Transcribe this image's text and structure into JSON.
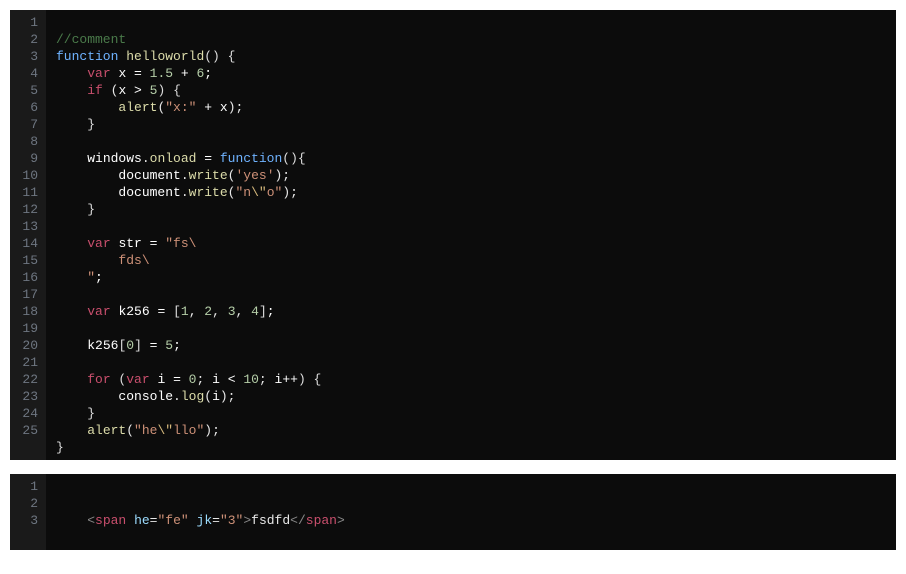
{
  "editors": [
    {
      "language": "javascript",
      "line_count": 25,
      "lines": {
        "l1": {
          "comment": "//comment"
        },
        "l2": {
          "kw": "function",
          "name": "helloworld",
          "p": "() {"
        },
        "l3": {
          "kw": "var",
          "id": "x",
          "eq": " = ",
          "n1": "1.5",
          "op": " + ",
          "n2": "6",
          "sc": ";"
        },
        "l4": {
          "kw": "if",
          "id": "x",
          "op": " > ",
          "n": "5",
          "close": ") {"
        },
        "l5": {
          "fn": "alert",
          "s1": "\"x:\"",
          "op": " + ",
          "id": "x"
        },
        "l6": {
          "brace": "}"
        },
        "l8": {
          "obj": "windows",
          "dot": ".",
          "prop": "onload",
          "eq": " = ",
          "kw": "function",
          "p": "(){"
        },
        "l9": {
          "obj": "document",
          "dot": ".",
          "fn": "write",
          "s": "'yes'"
        },
        "l10": {
          "obj": "document",
          "dot": ".",
          "fn": "write",
          "s1": "\"n",
          "esc": "\\\"",
          "s2": "o\""
        },
        "l11": {
          "brace": "}"
        },
        "l13": {
          "kw": "var",
          "id": "str",
          "eq": " = ",
          "s": "\"fs\\"
        },
        "l14": {
          "s": "fds\\"
        },
        "l15": {
          "s": "\"",
          "sc": ";"
        },
        "l17": {
          "kw": "var",
          "id": "k256",
          "eq": " = ",
          "lb": "[",
          "n1": "1",
          "c": ", ",
          "n2": "2",
          "n3": "3",
          "n4": "4",
          "rb": "]",
          "sc": ";"
        },
        "l19": {
          "id": "k256",
          "lb": "[",
          "n1": "0",
          "rb": "]",
          "eq": " = ",
          "n2": "5",
          "sc": ";"
        },
        "l21": {
          "kw": "for",
          "lp": " (",
          "kw2": "var",
          "id": "i",
          "eq": " = ",
          "n1": "0",
          "sc": "; ",
          "op1": " < ",
          "n2": "10",
          "op2": "++",
          "close": ") {"
        },
        "l22": {
          "obj": "console",
          "dot": ".",
          "fn": "log",
          "id": "i"
        },
        "l23": {
          "brace": "}"
        },
        "l24": {
          "fn": "alert",
          "s1": "\"he",
          "esc": "\\\"",
          "s2": "llo\""
        },
        "l25": {
          "brace": "}"
        }
      }
    },
    {
      "language": "html",
      "line_count": 3,
      "lines": {
        "l2": {
          "lt": "<",
          "tag": "span",
          "a1n": "he",
          "a1v": "\"fe\"",
          "a2n": "jk",
          "a2v": "\"3\"",
          "gt": ">",
          "text": "fsdfd",
          "lt2": "</",
          "tag2": "span",
          "gt2": ">"
        }
      }
    }
  ]
}
